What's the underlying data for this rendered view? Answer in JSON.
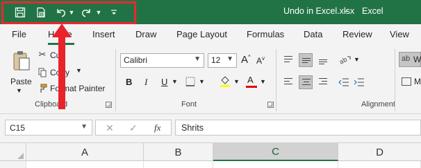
{
  "window": {
    "title": "Undo in Excel.xlsx",
    "separator": "-",
    "app_name": "Excel",
    "accent": "#217346",
    "highlight_color": "#e8282f"
  },
  "quick_access": {
    "icons": [
      "save-icon",
      "save-as-icon",
      "undo-icon",
      "redo-icon",
      "customize-qat-icon"
    ]
  },
  "menu": {
    "tabs": [
      "File",
      "Home",
      "Insert",
      "Draw",
      "Page Layout",
      "Formulas",
      "Data",
      "Review",
      "View"
    ],
    "active": "Home"
  },
  "ribbon": {
    "clipboard": {
      "paste_label": "Paste",
      "cut_label": "Cut",
      "copy_label": "Copy",
      "format_painter_label": "Format Painter",
      "group_label": "Clipboard"
    },
    "font": {
      "font_name": "Calibri",
      "font_size": "12",
      "group_label": "Font",
      "bold": "B",
      "italic": "I",
      "underline": "U",
      "font_color_label": "A"
    },
    "alignment": {
      "group_label": "Alignment",
      "wrap_label": "W"
    }
  },
  "formula_bar": {
    "name_box": "C15",
    "fx_label": "fx",
    "formula_value": "Shrits"
  },
  "grid": {
    "columns": [
      "A",
      "B",
      "C",
      "D"
    ],
    "selected_column": "C"
  }
}
